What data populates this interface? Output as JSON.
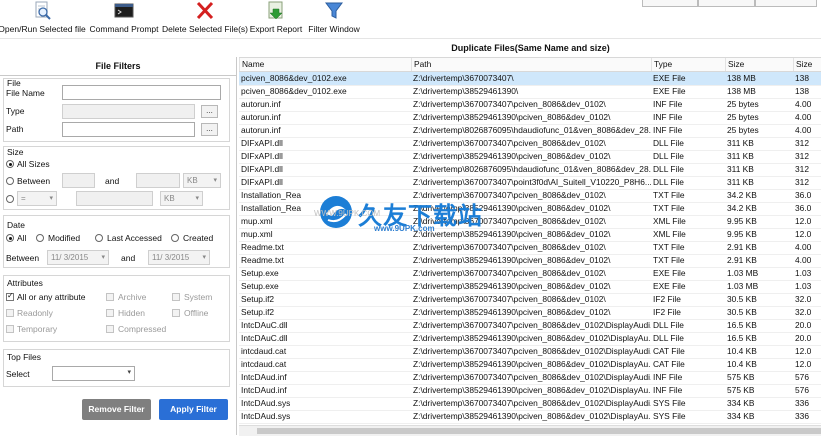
{
  "toolbar": {
    "open": "Open/Run Selected file",
    "command": "Command Prompt",
    "delete": "Delete Selected File(s)",
    "export": "Export Report",
    "filter": "Filter Window"
  },
  "results": {
    "title": "Duplicate Files(Same Name and size)",
    "columns": [
      "Name",
      "Path",
      "Type",
      "Size",
      "Size"
    ],
    "rows": [
      [
        "pciven_8086&dev_0102.exe",
        "Z:\\drivertemp\\3670073407\\",
        "EXE File",
        "138 MB",
        "138"
      ],
      [
        "pciven_8086&dev_0102.exe",
        "Z:\\drivertemp\\38529461390\\",
        "EXE File",
        "138 MB",
        "138"
      ],
      [
        "autorun.inf",
        "Z:\\drivertemp\\3670073407\\pciven_8086&dev_0102\\",
        "INF File",
        "25 bytes",
        "4.00"
      ],
      [
        "autorun.inf",
        "Z:\\drivertemp\\38529461390\\pciven_8086&dev_0102\\",
        "INF File",
        "25 bytes",
        "4.00"
      ],
      [
        "autorun.inf",
        "Z:\\drivertemp\\8026876095\\hdaudiofunc_01&ven_8086&dev_28...",
        "INF File",
        "25 bytes",
        "4.00"
      ],
      [
        "DIFxAPI.dll",
        "Z:\\drivertemp\\3670073407\\pciven_8086&dev_0102\\",
        "DLL File",
        "311 KB",
        "312"
      ],
      [
        "DIFxAPI.dll",
        "Z:\\drivertemp\\38529461390\\pciven_8086&dev_0102\\",
        "DLL File",
        "311 KB",
        "312"
      ],
      [
        "DIFxAPI.dll",
        "Z:\\drivertemp\\8026876095\\hdaudiofunc_01&ven_8086&dev_28...",
        "DLL File",
        "311 KB",
        "312"
      ],
      [
        "DIFxAPI.dll",
        "Z:\\drivertemp\\3670073407\\point3f0d\\AI_Suitell_V10220_P8H6...",
        "DLL File",
        "311 KB",
        "312"
      ],
      [
        "Installation_Rea",
        "Z:\\drivertemp\\3670073407\\pciven_8086&dev_0102\\",
        "TXT File",
        "34.2 KB",
        "36.0"
      ],
      [
        "Installation_Rea",
        "Z:\\drivertemp\\38529461390\\pciven_8086&dev_0102\\",
        "TXT File",
        "34.2 KB",
        "36.0"
      ],
      [
        "mup.xml",
        "Z:\\drivertemp\\3670073407\\pciven_8086&dev_0102\\",
        "XML File",
        "9.95 KB",
        "12.0"
      ],
      [
        "mup.xml",
        "Z:\\drivertemp\\38529461390\\pciven_8086&dev_0102\\",
        "XML File",
        "9.95 KB",
        "12.0"
      ],
      [
        "Readme.txt",
        "Z:\\drivertemp\\3670073407\\pciven_8086&dev_0102\\",
        "TXT File",
        "2.91 KB",
        "4.00"
      ],
      [
        "Readme.txt",
        "Z:\\drivertemp\\38529461390\\pciven_8086&dev_0102\\",
        "TXT File",
        "2.91 KB",
        "4.00"
      ],
      [
        "Setup.exe",
        "Z:\\drivertemp\\3670073407\\pciven_8086&dev_0102\\",
        "EXE File",
        "1.03 MB",
        "1.03"
      ],
      [
        "Setup.exe",
        "Z:\\drivertemp\\38529461390\\pciven_8086&dev_0102\\",
        "EXE File",
        "1.03 MB",
        "1.03"
      ],
      [
        "Setup.if2",
        "Z:\\drivertemp\\3670073407\\pciven_8086&dev_0102\\",
        "IF2 File",
        "30.5 KB",
        "32.0"
      ],
      [
        "Setup.if2",
        "Z:\\drivertemp\\38529461390\\pciven_8086&dev_0102\\",
        "IF2 File",
        "30.5 KB",
        "32.0"
      ],
      [
        "IntcDAuC.dll",
        "Z:\\drivertemp\\3670073407\\pciven_8086&dev_0102\\DisplayAudi...",
        "DLL File",
        "16.5 KB",
        "20.0"
      ],
      [
        "IntcDAuC.dll",
        "Z:\\drivertemp\\38529461390\\pciven_8086&dev_0102\\DisplayAu...",
        "DLL File",
        "16.5 KB",
        "20.0"
      ],
      [
        "intcdaud.cat",
        "Z:\\drivertemp\\3670073407\\pciven_8086&dev_0102\\DisplayAudi...",
        "CAT File",
        "10.4 KB",
        "12.0"
      ],
      [
        "intcdaud.cat",
        "Z:\\drivertemp\\38529461390\\pciven_8086&dev_0102\\DisplayAu...",
        "CAT File",
        "10.4 KB",
        "12.0"
      ],
      [
        "IntcDAud.inf",
        "Z:\\drivertemp\\3670073407\\pciven_8086&dev_0102\\DisplayAudi...",
        "INF File",
        "575 KB",
        "576"
      ],
      [
        "IntcDAud.inf",
        "Z:\\drivertemp\\38529461390\\pciven_8086&dev_0102\\DisplayAu...",
        "INF File",
        "575 KB",
        "576"
      ],
      [
        "IntcDAud.sys",
        "Z:\\drivertemp\\3670073407\\pciven_8086&dev_0102\\DisplayAudi...",
        "SYS File",
        "334 KB",
        "336"
      ],
      [
        "IntcDAud.sys",
        "Z:\\drivertemp\\38529461390\\pciven_8086&dev_0102\\DisplayAu...",
        "SYS File",
        "334 KB",
        "336"
      ]
    ]
  },
  "filters": {
    "title": "File Filters",
    "file_group": "File",
    "file_name": "File Name",
    "type": "Type",
    "path": "Path",
    "browse": "...",
    "size_group": "Size",
    "all_sizes": "All Sizes",
    "between": "Between",
    "and": "and",
    "unit": "KB",
    "op": "=",
    "date_group": "Date",
    "all": "All",
    "modified": "Modified",
    "last_accessed": "Last Accessed",
    "created": "Created",
    "date_between": "Between",
    "date_from": "11/ 3/2015",
    "date_to": "11/ 3/2015",
    "attr_group": "Attributes",
    "all_attr": "All or any attribute",
    "archive": "Archive",
    "system": "System",
    "readonly": "Readonly",
    "hidden": "Hidden",
    "offline": "Offline",
    "temporary": "Temporary",
    "compressed": "Compressed",
    "top_group": "Top Files",
    "select": "Select",
    "remove_btn": "Remove Filter",
    "apply_btn": "Apply Filter"
  },
  "watermark": {
    "cn": "久友下载站",
    "url": "www.9UPK.com",
    "url_faded": "WWW.9UPK.COM"
  },
  "colors": {
    "selected_row": "#cfe7fb",
    "remove_btn": "#7f7f7f",
    "apply_btn": "#2a6fd6",
    "watermark": "#1c7ed6"
  }
}
